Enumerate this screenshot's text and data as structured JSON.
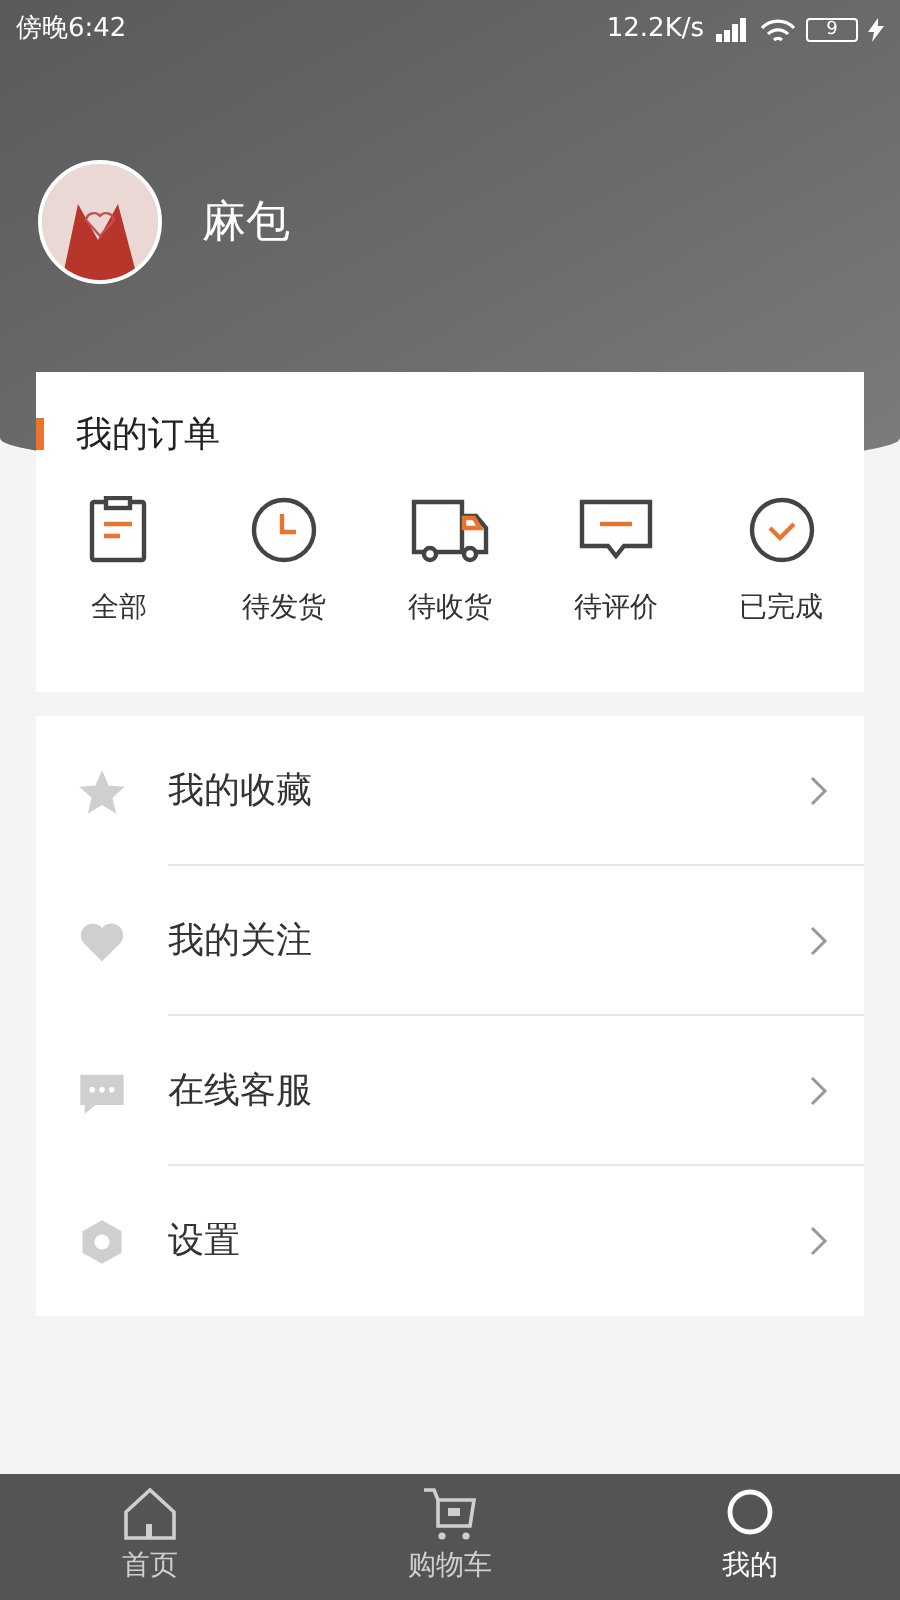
{
  "status_bar": {
    "time": "傍晚6:42",
    "speed": "12.2K/s",
    "battery": "9"
  },
  "profile": {
    "name": "麻包"
  },
  "orders": {
    "title": "我的订单",
    "items": [
      {
        "kind": "clipboard",
        "label": "全部"
      },
      {
        "kind": "clock",
        "label": "待发货"
      },
      {
        "kind": "truck",
        "label": "待收货"
      },
      {
        "kind": "comment",
        "label": "待评价"
      },
      {
        "kind": "check",
        "label": "已完成"
      }
    ]
  },
  "menu": [
    {
      "kind": "star",
      "label": "我的收藏"
    },
    {
      "kind": "heart",
      "label": "我的关注"
    },
    {
      "kind": "chat",
      "label": "在线客服"
    },
    {
      "kind": "settings",
      "label": "设置"
    }
  ],
  "tabs": [
    {
      "kind": "home",
      "label": "首页",
      "selected": false
    },
    {
      "kind": "cart",
      "label": "购物车",
      "selected": false
    },
    {
      "kind": "me",
      "label": "我的",
      "selected": true
    }
  ]
}
